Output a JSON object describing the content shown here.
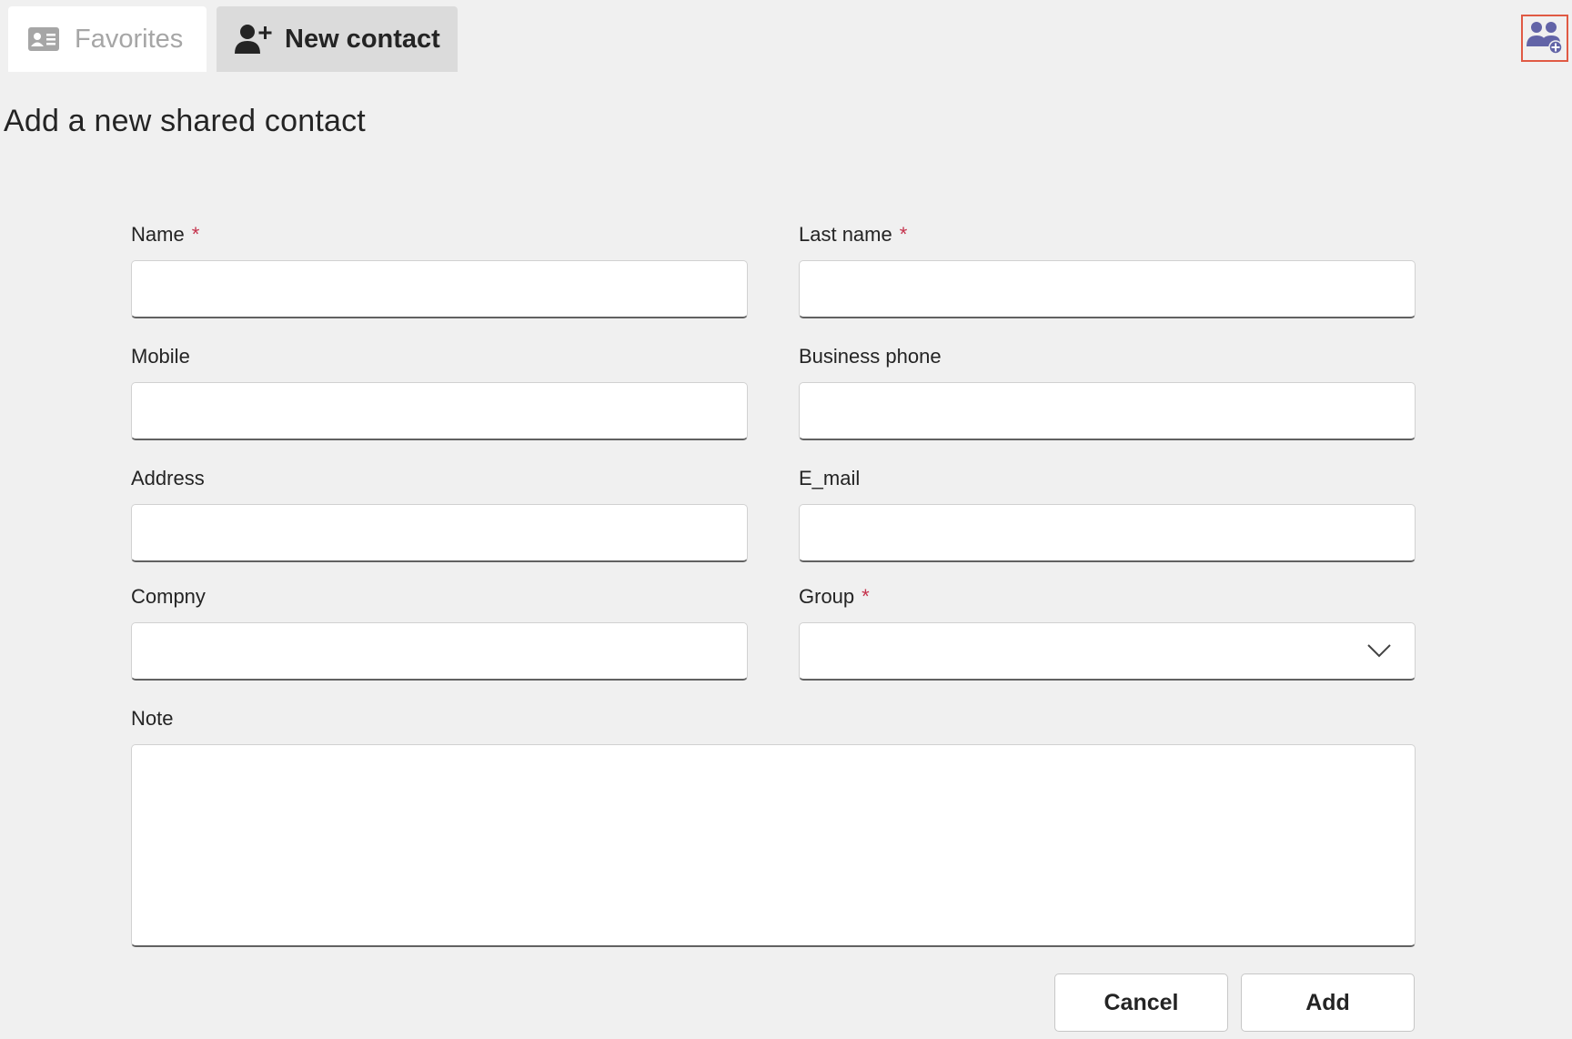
{
  "tabs": {
    "favorites": {
      "label": "Favorites",
      "icon": "contact-card-icon"
    },
    "new_contact": {
      "label": "New contact",
      "icon": "person-add-icon"
    }
  },
  "header": {
    "team_button_icon": "people-add-icon"
  },
  "page": {
    "title": "Add a new shared contact"
  },
  "form": {
    "name": {
      "label": "Name",
      "required_mark": "*",
      "value": ""
    },
    "last_name": {
      "label": "Last name",
      "required_mark": "*",
      "value": ""
    },
    "mobile": {
      "label": "Mobile",
      "value": ""
    },
    "business_phone": {
      "label": "Business phone",
      "value": ""
    },
    "address": {
      "label": "Address",
      "value": ""
    },
    "email": {
      "label": "E_mail",
      "value": ""
    },
    "company": {
      "label": "Compny",
      "value": ""
    },
    "group": {
      "label": "Group",
      "required_mark": "*",
      "selected": ""
    },
    "note": {
      "label": "Note",
      "value": ""
    }
  },
  "actions": {
    "cancel": "Cancel",
    "add": "Add"
  },
  "colors": {
    "background": "#f0f0f0",
    "accent_icon": "#6264a7",
    "required": "#c4314b",
    "focus_outline": "#e05a44"
  }
}
